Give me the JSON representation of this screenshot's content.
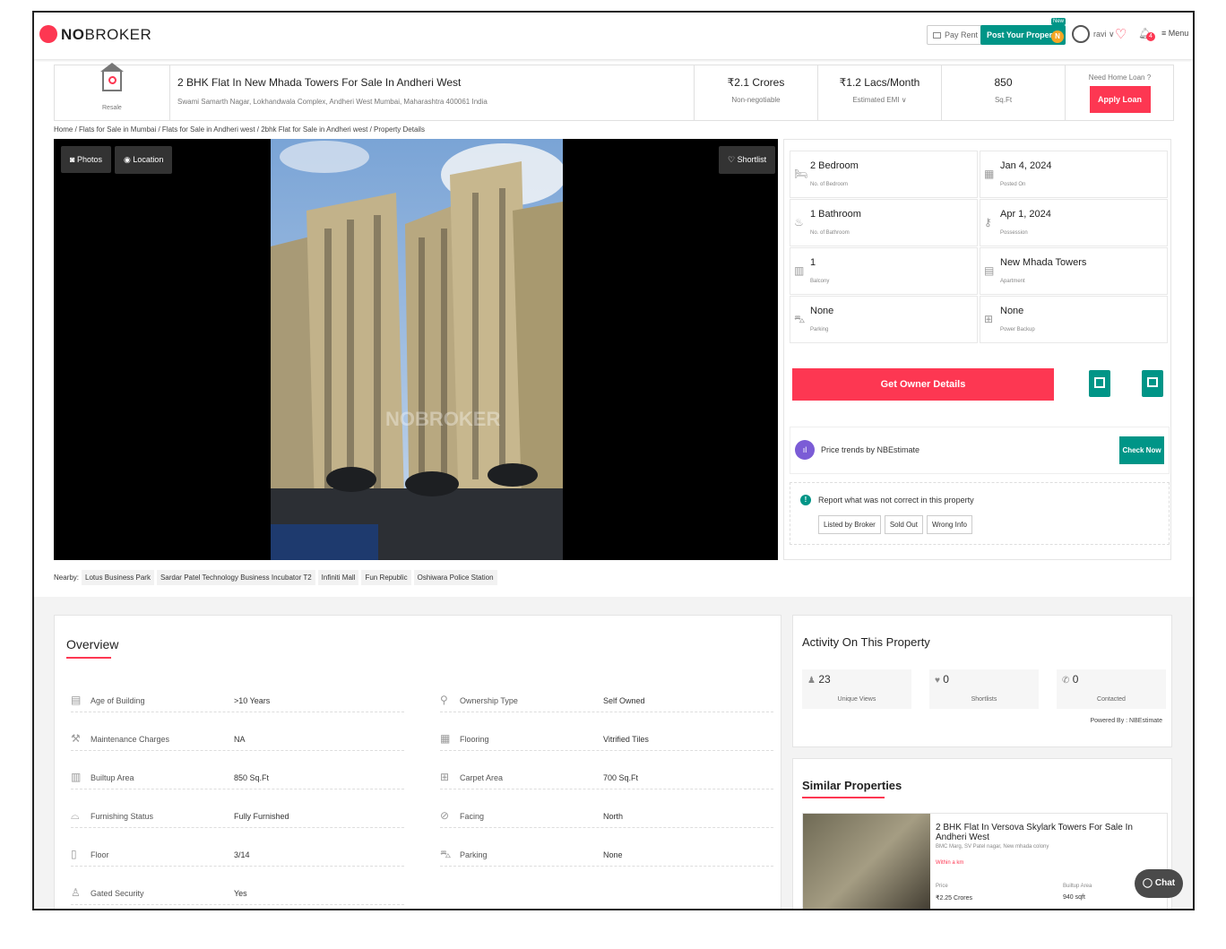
{
  "brand": {
    "no": "NO",
    "broker": "BROKER"
  },
  "header": {
    "pay_rent": "Pay Rent",
    "post_property": "Post Your Property",
    "new_badge": "New",
    "user": "ravi",
    "notif_count": "4",
    "menu": "Menu"
  },
  "listing": {
    "type": "Resale",
    "title": "2 BHK Flat In New Mhada Towers For Sale In Andheri West",
    "address": "Swami Samarth Nagar, Lokhandwala Complex, Andheri West Mumbai, Maharashtra 400061 India",
    "price": "₹2.1 Crores",
    "price_note": "Non-negotiable",
    "emi": "₹1.2 Lacs/Month",
    "emi_note": "Estimated EMI ∨",
    "area": "850",
    "area_unit": "Sq.Ft",
    "loan_q": "Need Home Loan ?",
    "apply_loan": "Apply Loan"
  },
  "breadcrumb": "Home / Flats for Sale in Mumbai / Flats for Sale in Andheri west / 2bhk Flat for Sale in Andheri west / Property Details",
  "photo": {
    "photos": "Photos",
    "location": "Location",
    "shortlist": "Shortlist",
    "watermark": "NOBROKER"
  },
  "details": [
    {
      "value": "2 Bedroom",
      "label": "No. of Bedroom",
      "icon": "bed-icon"
    },
    {
      "value": "Jan 4, 2024",
      "label": "Posted On",
      "icon": "calendar-icon"
    },
    {
      "value": "1 Bathroom",
      "label": "No. of Bathroom",
      "icon": "bath-icon"
    },
    {
      "value": "Apr 1, 2024",
      "label": "Possession",
      "icon": "key-icon"
    },
    {
      "value": "1",
      "label": "Balcony",
      "icon": "balcony-icon"
    },
    {
      "value": "New Mhada Towers",
      "label": "Apartment",
      "icon": "building-icon"
    },
    {
      "value": "None",
      "label": "Parking",
      "icon": "car-icon"
    },
    {
      "value": "None",
      "label": "Power Backup",
      "icon": "battery-icon"
    }
  ],
  "owner_btn": "Get Owner Details",
  "price_trends": {
    "label": "Price trends by NBEstimate",
    "btn": "Check Now"
  },
  "report": {
    "q": "Report what was not correct in this property",
    "opts": [
      "Listed by Broker",
      "Sold Out",
      "Wrong Info"
    ]
  },
  "nearby": {
    "label": "Nearby:",
    "items": [
      "Lotus Business Park",
      "Sardar Patel Technology Business Incubator T2",
      "Infiniti Mall",
      "Fun Republic",
      "Oshiwara Police Station"
    ]
  },
  "overview": {
    "title": "Overview",
    "left": [
      {
        "label": "Age of Building",
        "value": ">10 Years",
        "icon": "building-age-icon"
      },
      {
        "label": "Maintenance Charges",
        "value": "NA",
        "icon": "maintenance-icon"
      },
      {
        "label": "Builtup Area",
        "value": "850 Sq.Ft",
        "icon": "builtup-icon"
      },
      {
        "label": "Furnishing Status",
        "value": "Fully Furnished",
        "icon": "sofa-icon"
      },
      {
        "label": "Floor",
        "value": "3/14",
        "icon": "floor-icon"
      },
      {
        "label": "Gated Security",
        "value": "Yes",
        "icon": "security-icon"
      }
    ],
    "right": [
      {
        "label": "Ownership Type",
        "value": "Self Owned",
        "icon": "ownership-icon"
      },
      {
        "label": "Flooring",
        "value": "Vitrified Tiles",
        "icon": "flooring-icon"
      },
      {
        "label": "Carpet Area",
        "value": "700 Sq.Ft",
        "icon": "carpet-icon"
      },
      {
        "label": "Facing",
        "value": "North",
        "icon": "compass-icon"
      },
      {
        "label": "Parking",
        "value": "None",
        "icon": "car-icon"
      }
    ]
  },
  "activity": {
    "title": "Activity On This Property",
    "views": "23",
    "views_label": "Unique Views",
    "shortlists": "0",
    "shortlists_label": "Shortlists",
    "contacted": "0",
    "contacted_label": "Contacted",
    "powered": "Powered By : NBEstimate"
  },
  "similar": {
    "title": "Similar Properties",
    "item_title": "2 BHK Flat In Versova Skylark Towers For Sale In Andheri West",
    "item_addr": "BMC Marg, SV Patel nagar, New mhada colony",
    "item_dist": "Within a km",
    "price_label": "Price",
    "price": "₹2.25 Crores",
    "area_label": "Builtup Area",
    "area": "940 sqft"
  },
  "chat": "Chat",
  "colors": {
    "brand": "#fd3752",
    "green": "#009587"
  }
}
